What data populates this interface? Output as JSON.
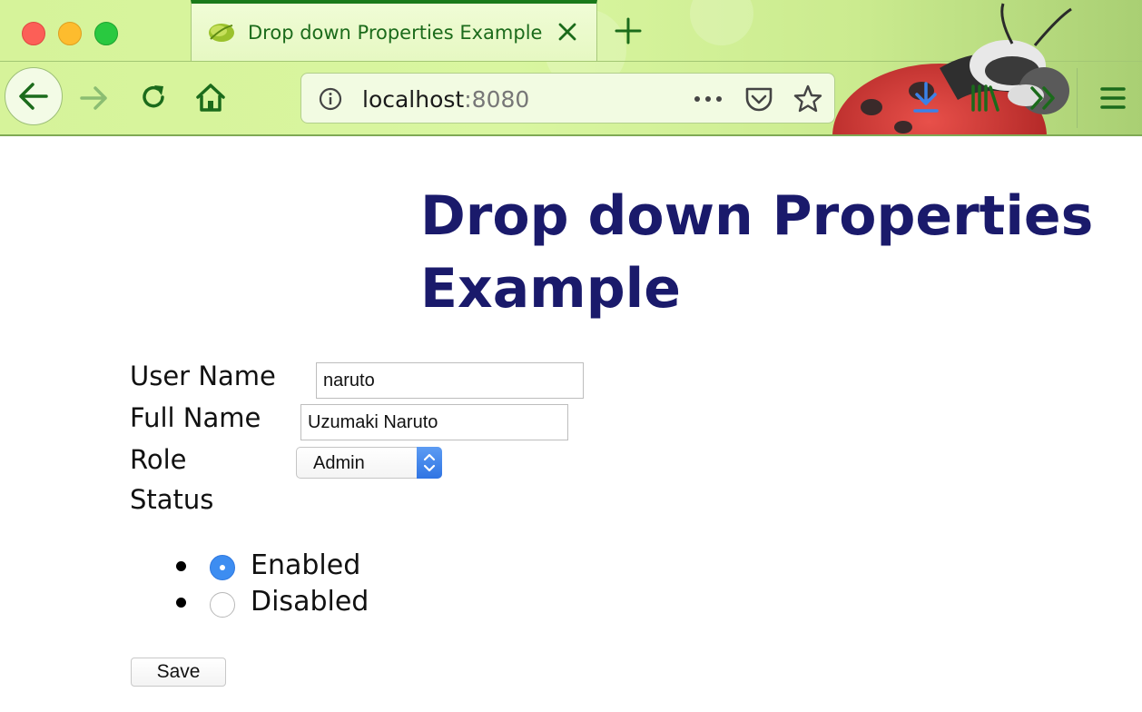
{
  "browser": {
    "tab_title": "Drop down Properties Example",
    "url_host": "localhost",
    "url_port": ":8080"
  },
  "page": {
    "heading": "Drop down Properties Example"
  },
  "form": {
    "username_label": "User Name",
    "username_value": "naruto",
    "fullname_label": "Full Name",
    "fullname_value": "Uzumaki Naruto",
    "role_label": "Role",
    "role_selected": "Admin",
    "status_label": "Status",
    "status_options": [
      "Enabled",
      "Disabled"
    ],
    "status_selected": "Enabled",
    "save_label": "Save"
  },
  "colors": {
    "heading": "#1a1a6b",
    "chrome_accent": "#1a7a1a",
    "radio_selected": "#3d8df1"
  },
  "icons": [
    "back-arrow-icon",
    "forward-arrow-icon",
    "reload-icon",
    "home-icon",
    "info-icon",
    "more-icon",
    "pocket-icon",
    "star-icon",
    "download-icon",
    "library-icon",
    "overflow-icon",
    "menu-icon",
    "close-icon",
    "plus-icon"
  ]
}
